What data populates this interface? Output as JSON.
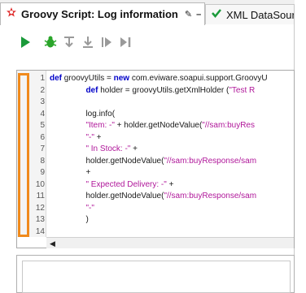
{
  "tabs": [
    {
      "label": "Groovy Script: Log information",
      "icon": "groovy-star-icon",
      "active": true
    },
    {
      "label": "XML DataSour",
      "icon": "checkmark-icon",
      "active": false
    }
  ],
  "tab_controls": {
    "pin": "✎",
    "minimize": "–",
    "close": "✕"
  },
  "toolbar": {
    "buttons": [
      "run-icon",
      "debug-bug-icon",
      "step-over-icon",
      "step-into-icon",
      "resume-icon",
      "run-to-end-icon"
    ]
  },
  "editor": {
    "line_numbers": [
      "1",
      "2",
      "3",
      "4",
      "5",
      "6",
      "7",
      "8",
      "9",
      "10",
      "11",
      "12",
      "13",
      "14"
    ],
    "lines": [
      [
        {
          "t": "def",
          "c": "kw"
        },
        {
          "t": " groovyUtils = ",
          "c": ""
        },
        {
          "t": "new",
          "c": "kw"
        },
        {
          "t": " com.eviware.soapui.support.GroovyU",
          "c": ""
        }
      ],
      [
        {
          "t": "                ",
          "c": ""
        },
        {
          "t": "def",
          "c": "kw"
        },
        {
          "t": " holder = groovyUtils.getXmlHolder (",
          "c": ""
        },
        {
          "t": "\"Test R",
          "c": "str"
        }
      ],
      [
        {
          "t": "",
          "c": ""
        }
      ],
      [
        {
          "t": "                log.info(",
          "c": ""
        }
      ],
      [
        {
          "t": "                ",
          "c": ""
        },
        {
          "t": "\"Item: -\"",
          "c": "str"
        },
        {
          "t": " + holder.getNodeValue(",
          "c": ""
        },
        {
          "t": "\"//sam:buyRes",
          "c": "str"
        }
      ],
      [
        {
          "t": "                ",
          "c": ""
        },
        {
          "t": "\"-\"",
          "c": "str"
        },
        {
          "t": " +",
          "c": ""
        }
      ],
      [
        {
          "t": "                ",
          "c": ""
        },
        {
          "t": "\" In Stock: -\"",
          "c": "str"
        },
        {
          "t": " +",
          "c": ""
        }
      ],
      [
        {
          "t": "                holder.getNodeValue(",
          "c": ""
        },
        {
          "t": "\"//sam:buyResponse/sam",
          "c": "str"
        }
      ],
      [
        {
          "t": "                +",
          "c": ""
        }
      ],
      [
        {
          "t": "                ",
          "c": ""
        },
        {
          "t": "\" Expected Delivery: -\"",
          "c": "str"
        },
        {
          "t": " +",
          "c": ""
        }
      ],
      [
        {
          "t": "                holder.getNodeValue(",
          "c": ""
        },
        {
          "t": "\"//sam:buyResponse/sam",
          "c": "str"
        }
      ],
      [
        {
          "t": "                ",
          "c": ""
        },
        {
          "t": "\"-\"",
          "c": "str"
        }
      ],
      [
        {
          "t": "                )",
          "c": ""
        }
      ],
      [
        {
          "t": "",
          "c": ""
        }
      ]
    ]
  },
  "colors": {
    "accent_highlight": "#f08a1c",
    "keyword": "#0000c8",
    "string": "#b0179a",
    "run_green": "#1a9a3a"
  }
}
